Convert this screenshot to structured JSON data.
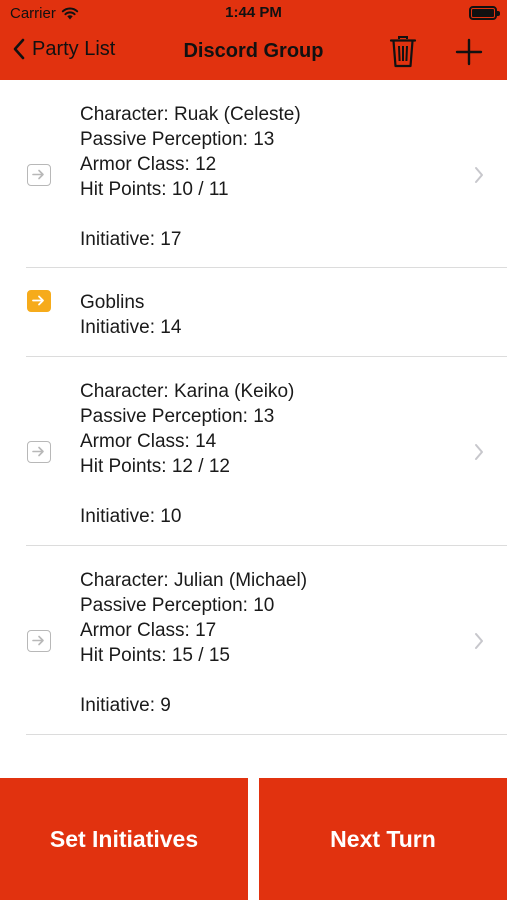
{
  "status_bar": {
    "carrier": "Carrier",
    "time": "1:44 PM"
  },
  "nav": {
    "back_label": "Party List",
    "title": "Discord Group"
  },
  "rows": [
    {
      "turn_active": false,
      "has_detail": true,
      "lines": [
        "Character: Ruak (Celeste)",
        "Passive Perception: 13",
        "Armor Class: 12",
        "Hit Points: 10 / 11"
      ],
      "initiative": "Initiative: 17"
    },
    {
      "turn_active": true,
      "has_detail": false,
      "lines": [
        "Goblins"
      ],
      "initiative": "Initiative: 14"
    },
    {
      "turn_active": false,
      "has_detail": true,
      "lines": [
        "Character: Karina (Keiko)",
        "Passive Perception: 13",
        "Armor Class: 14",
        "Hit Points: 12 / 12"
      ],
      "initiative": "Initiative: 10"
    },
    {
      "turn_active": false,
      "has_detail": true,
      "lines": [
        "Character: Julian (Michael)",
        "Passive Perception: 10",
        "Armor Class: 17",
        "Hit Points: 15 / 15"
      ],
      "initiative": "Initiative: 9"
    }
  ],
  "bottom": {
    "set_initiatives_label": "Set Initiatives",
    "next_turn_label": "Next Turn"
  },
  "colors": {
    "accent": "#e1320f",
    "active_turn": "#f6ab1b",
    "separator": "#dcdcdc"
  },
  "icons": {
    "back": "chevron-left-icon",
    "trash": "trash-icon",
    "add": "plus-icon",
    "turn": "arrow-right-square-icon",
    "detail": "chevron-right-icon",
    "wifi": "wifi-icon",
    "battery": "battery-icon"
  }
}
